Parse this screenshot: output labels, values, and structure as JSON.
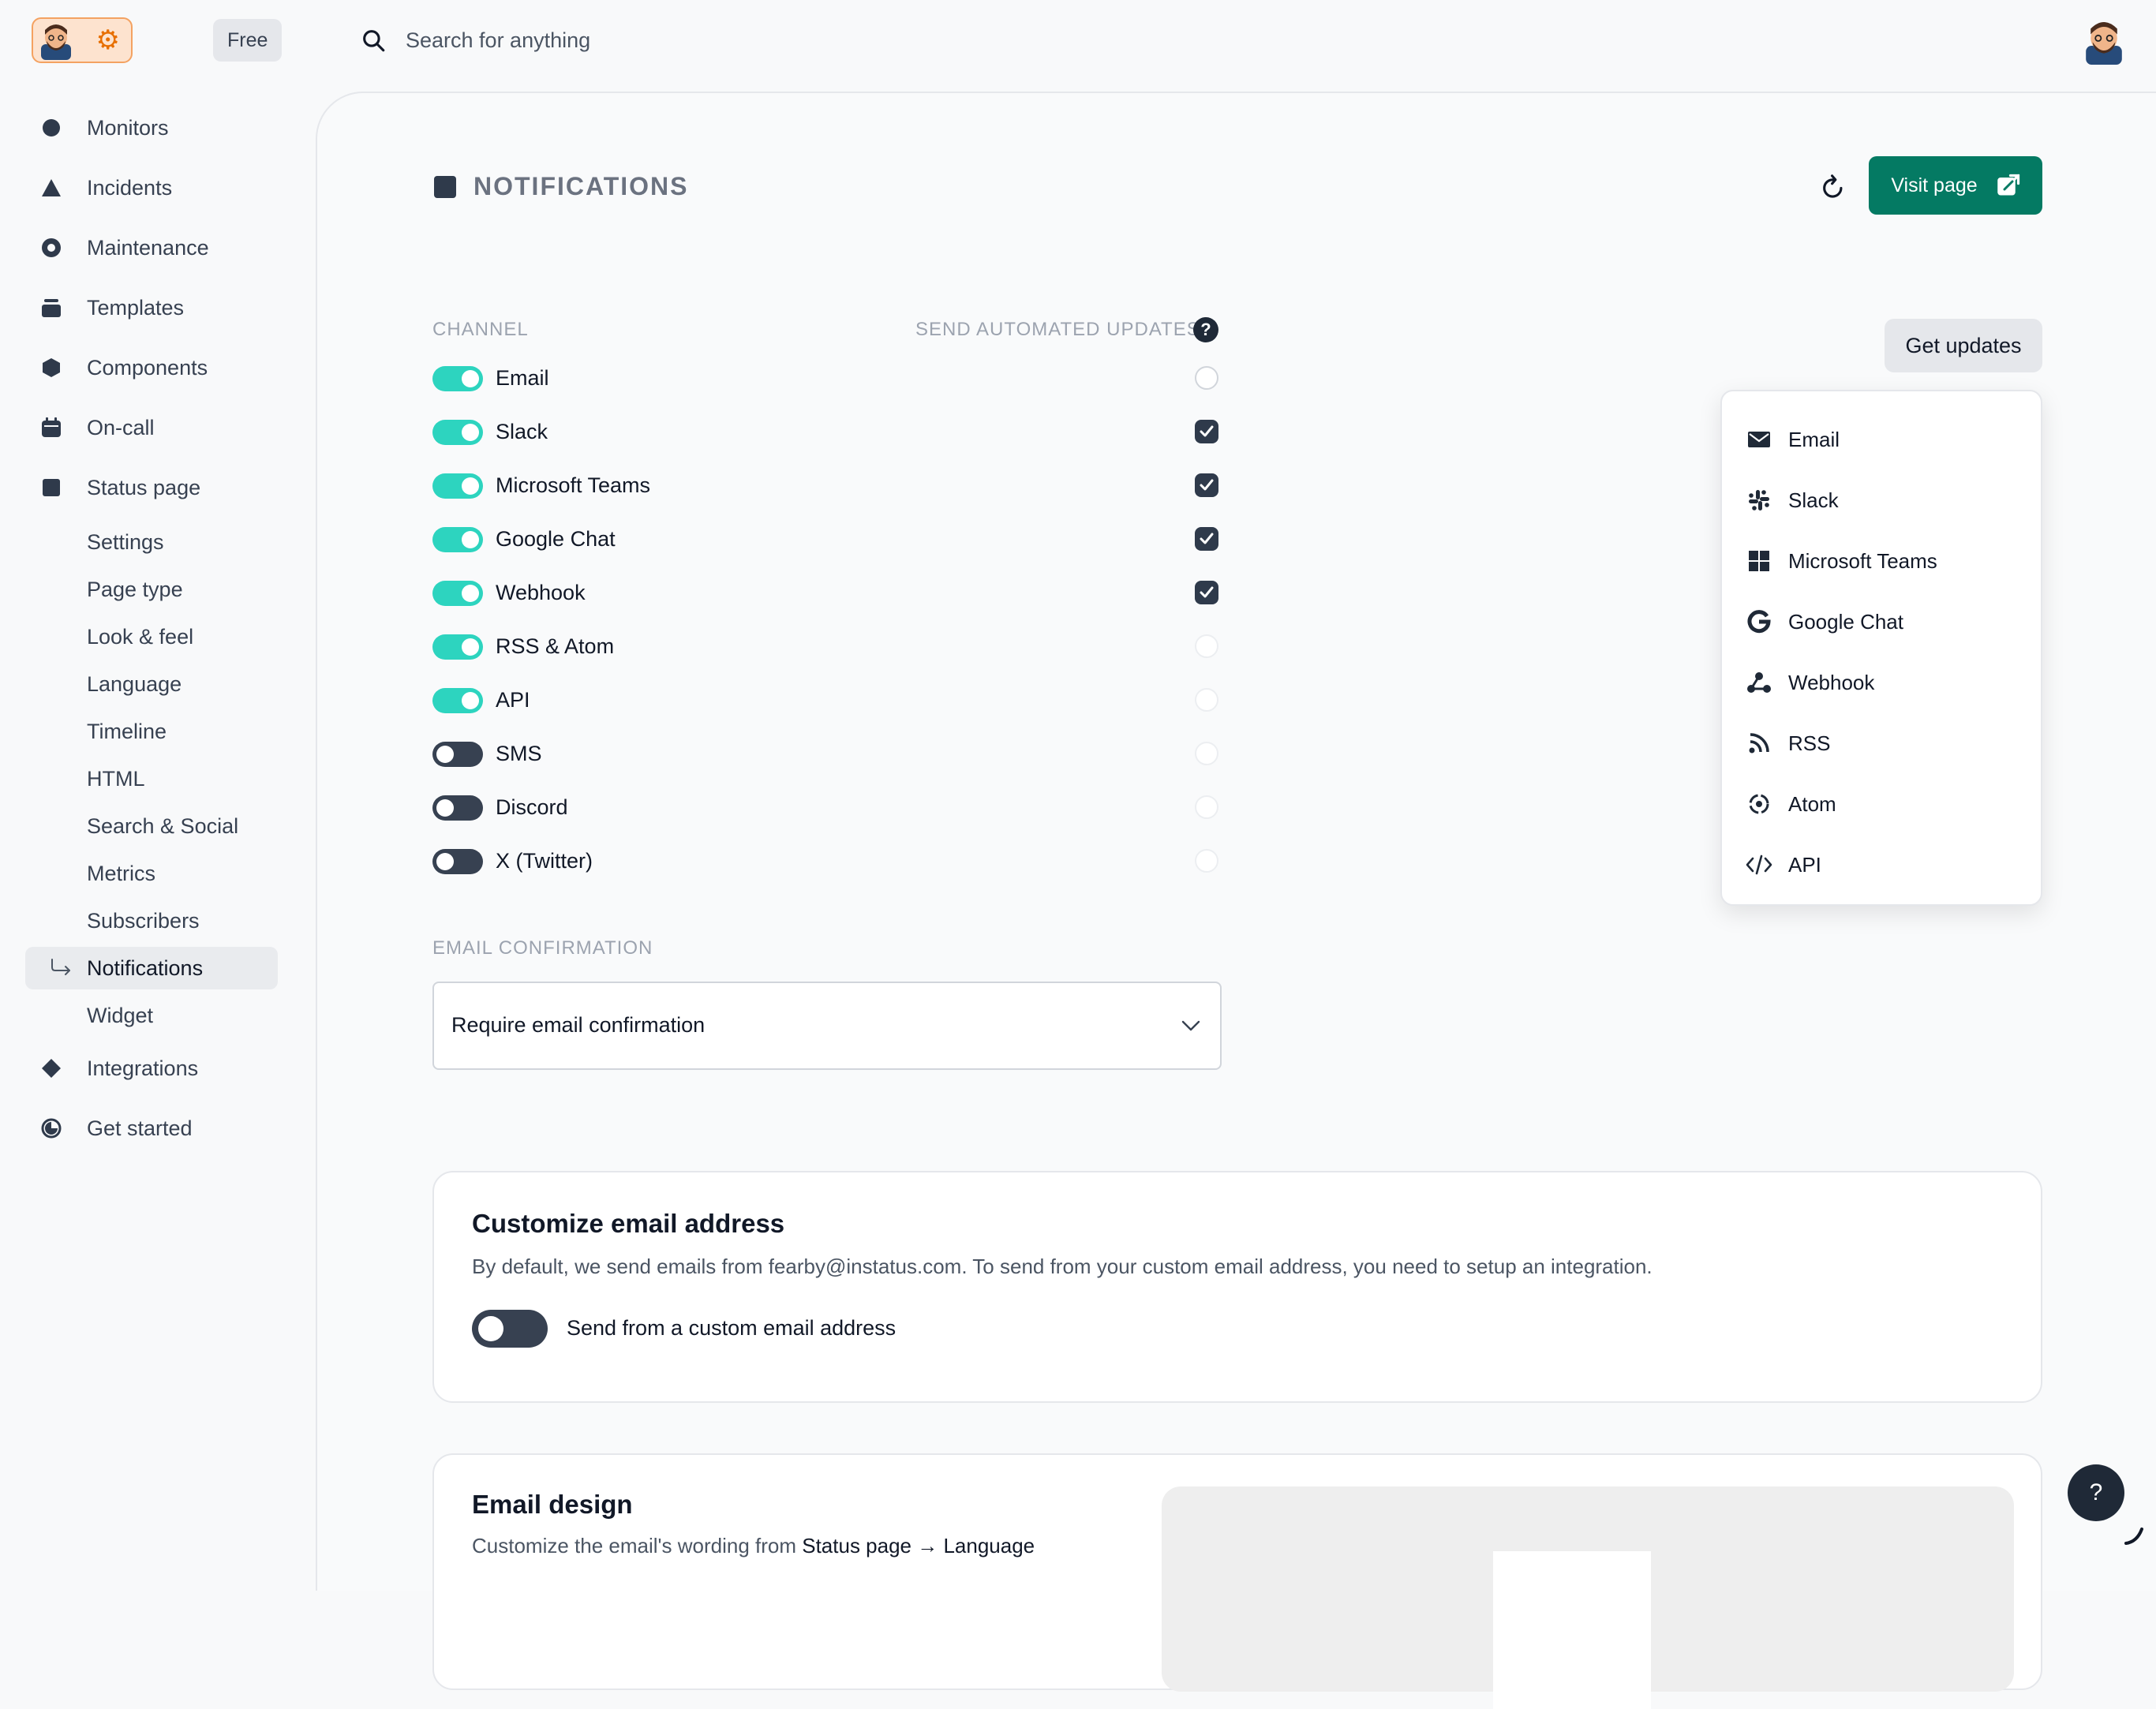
{
  "topbar": {
    "plan_badge": "Free",
    "search_placeholder": "Search for anything"
  },
  "sidebar": {
    "items": [
      {
        "label": "Monitors",
        "icon": "circle-icon"
      },
      {
        "label": "Incidents",
        "icon": "triangle-icon"
      },
      {
        "label": "Maintenance",
        "icon": "ring-icon"
      },
      {
        "label": "Templates",
        "icon": "stack-icon"
      },
      {
        "label": "Components",
        "icon": "hexagon-icon"
      },
      {
        "label": "On-call",
        "icon": "calendar-icon"
      },
      {
        "label": "Status page",
        "icon": "square-icon"
      }
    ],
    "status_page_sub": [
      "Settings",
      "Page type",
      "Look & feel",
      "Language",
      "Timeline",
      "HTML",
      "Search & Social",
      "Metrics",
      "Subscribers",
      "Notifications",
      "Widget"
    ],
    "active_sub": "Notifications",
    "bottom_items": [
      {
        "label": "Integrations",
        "icon": "diamond-icon"
      },
      {
        "label": "Get started",
        "icon": "progress-icon"
      }
    ]
  },
  "main": {
    "title": "NOTIFICATIONS",
    "visit_label": "Visit page",
    "channel_header": "CHANNEL",
    "updates_header": "SEND AUTOMATED UPDATES",
    "help_glyph": "?",
    "channels": [
      {
        "name": "Email",
        "enabled": true,
        "auto_updates": false
      },
      {
        "name": "Slack",
        "enabled": true,
        "auto_updates": true
      },
      {
        "name": "Microsoft Teams",
        "enabled": true,
        "auto_updates": true
      },
      {
        "name": "Google Chat",
        "enabled": true,
        "auto_updates": true
      },
      {
        "name": "Webhook",
        "enabled": true,
        "auto_updates": true
      },
      {
        "name": "RSS & Atom",
        "enabled": true,
        "auto_updates": false
      },
      {
        "name": "API",
        "enabled": true,
        "auto_updates": false
      },
      {
        "name": "SMS",
        "enabled": false,
        "auto_updates": false
      },
      {
        "name": "Discord",
        "enabled": false,
        "auto_updates": false
      },
      {
        "name": "X (Twitter)",
        "enabled": false,
        "auto_updates": false
      }
    ],
    "email_confirmation_header": "EMAIL CONFIRMATION",
    "email_confirmation_value": "Require email confirmation",
    "get_updates_label": "Get updates",
    "dropdown_items": [
      {
        "label": "Email",
        "icon": "envelope-icon"
      },
      {
        "label": "Slack",
        "icon": "slack-icon"
      },
      {
        "label": "Microsoft Teams",
        "icon": "windows-icon"
      },
      {
        "label": "Google Chat",
        "icon": "google-icon"
      },
      {
        "label": "Webhook",
        "icon": "webhook-icon"
      },
      {
        "label": "RSS",
        "icon": "rss-icon"
      },
      {
        "label": "Atom",
        "icon": "atom-icon"
      },
      {
        "label": "API",
        "icon": "code-icon"
      }
    ],
    "custom_email_card": {
      "title": "Customize email address",
      "description": "By default, we send emails from fearby@instatus.com. To send from your custom email address, you need to setup an integration.",
      "toggle_label": "Send from a custom email address"
    },
    "email_design_card": {
      "title": "Email design",
      "description_prefix": "Customize the email's wording from ",
      "description_link": "Status page → Language"
    }
  },
  "help_fab": "?",
  "colors": {
    "accent": "#047a63",
    "toggle_on": "#2dd4bf",
    "toggle_off": "#374151",
    "dark": "#2f3a4b"
  }
}
